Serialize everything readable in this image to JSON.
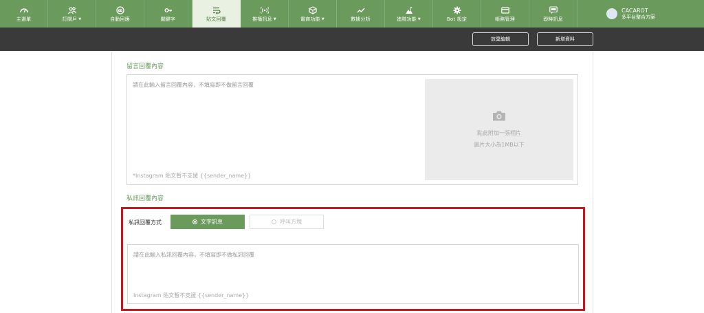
{
  "nav": {
    "items": [
      {
        "label": "主選單",
        "icon": "speedometer-icon",
        "dropdown": false,
        "active": false
      },
      {
        "label": "訂閱戶",
        "icon": "users-icon",
        "dropdown": true,
        "active": false
      },
      {
        "label": "自動回應",
        "icon": "robot-icon",
        "dropdown": false,
        "active": false
      },
      {
        "label": "關鍵字",
        "icon": "key-icon",
        "dropdown": false,
        "active": false
      },
      {
        "label": "貼文回覆",
        "icon": "reply-lines-icon",
        "dropdown": false,
        "active": true
      },
      {
        "label": "推播訊息",
        "icon": "broadcast-icon",
        "dropdown": true,
        "active": false
      },
      {
        "label": "電商功能",
        "icon": "box-icon",
        "dropdown": true,
        "active": false
      },
      {
        "label": "數據分析",
        "icon": "line-chart-icon",
        "dropdown": false,
        "active": false
      },
      {
        "label": "進階功能",
        "icon": "mountain-flag-icon",
        "dropdown": true,
        "active": false
      },
      {
        "label": "Bot 設定",
        "icon": "gear-icon",
        "dropdown": false,
        "active": false
      },
      {
        "label": "帳務管理",
        "icon": "credit-card-icon",
        "dropdown": false,
        "active": false
      },
      {
        "label": "即時訊息",
        "icon": "live-chat-icon",
        "dropdown": false,
        "active": false
      }
    ],
    "caret": "▼"
  },
  "user": {
    "name": "CACAROT",
    "subtitle": "多平台整合方案"
  },
  "actions": {
    "discard_label": "放棄編輯",
    "add_label": "新增資料"
  },
  "comment_section": {
    "title": "留言回覆內容",
    "placeholder": "請在此輸入留言回覆內容，不填寫即不做留言回覆",
    "note": "*Instagram 貼文暫不支援 {{sender_name}}",
    "upload_line1": "點此附加一張相片",
    "upload_line2": "圖片大小為1MB以下"
  },
  "dm_section": {
    "title": "私訊回覆內容",
    "method_label": "私訊回覆方式",
    "option_text": "文字訊息",
    "option_call": "呼叫方塊",
    "selected": "文字訊息",
    "placeholder": "請在此輸入私訊回覆內容，不填寫即不做私訊回覆",
    "note": "Instagram 貼文暫不支援 {{sender_name}}"
  },
  "colors": {
    "primary": "#6a9a5c",
    "nav_active_bg": "#e9f1e2",
    "action_bar": "#3a3a3a",
    "highlight": "#c8181f"
  }
}
